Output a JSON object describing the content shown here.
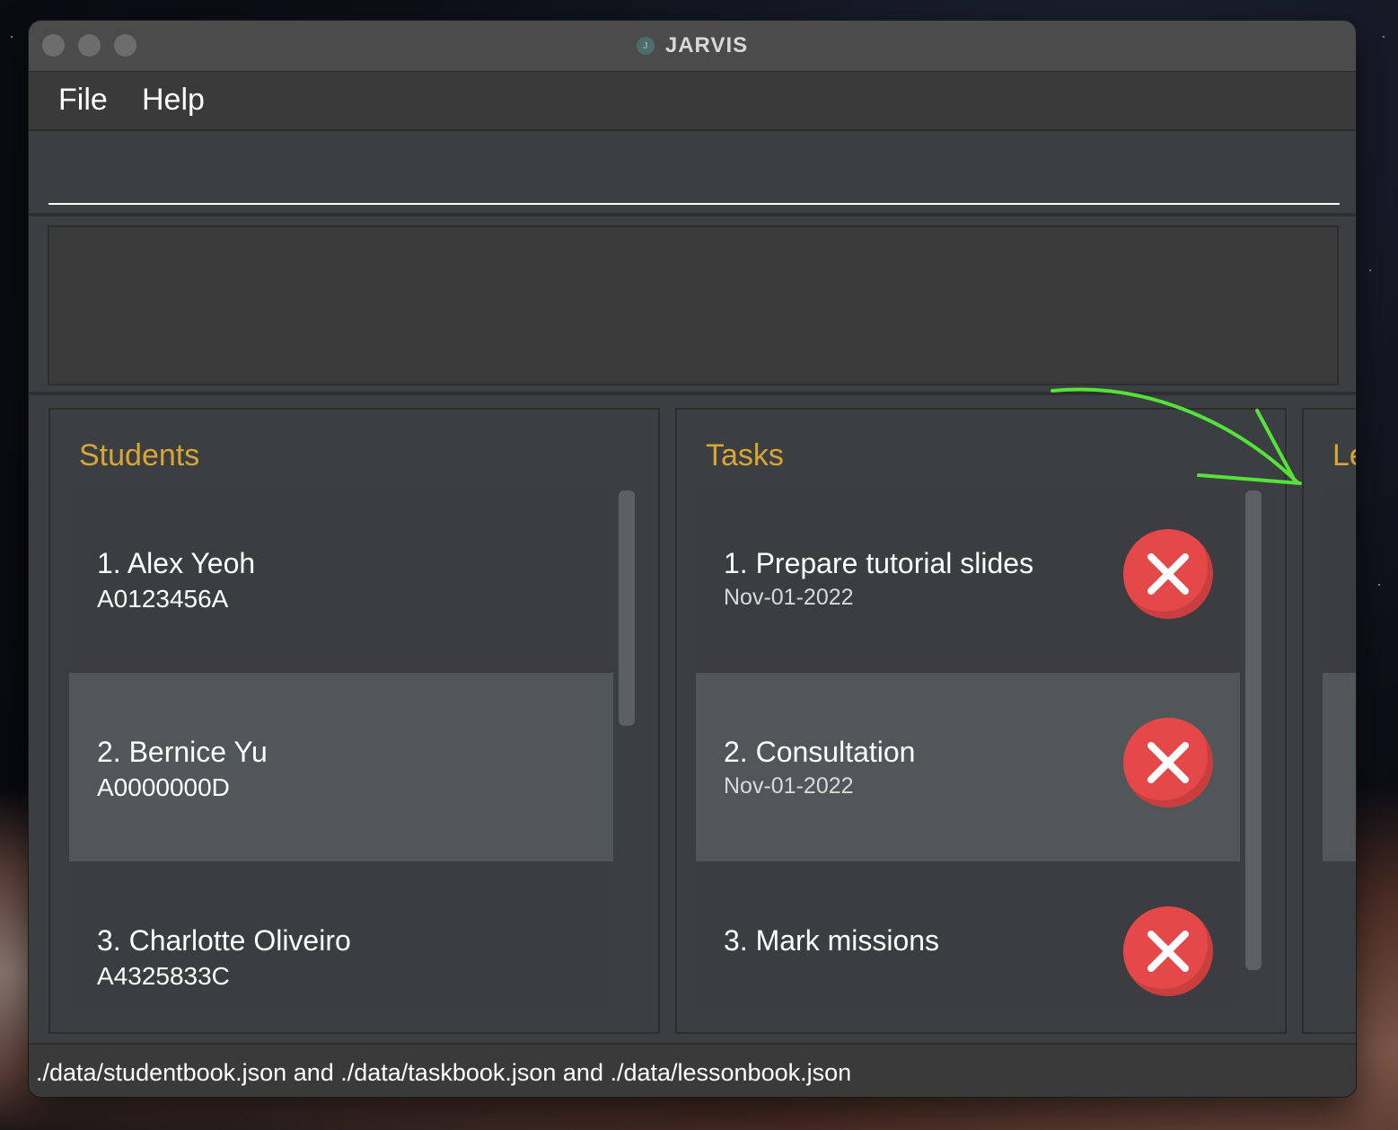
{
  "window": {
    "title": "JARVIS"
  },
  "menu": {
    "file": "File",
    "help": "Help"
  },
  "command": {
    "value": "",
    "placeholder": ""
  },
  "result": {
    "text": ""
  },
  "students": {
    "title": "Students",
    "items": [
      {
        "label": "1.  Alex Yeoh",
        "id": "A0123456A"
      },
      {
        "label": "2.  Bernice Yu",
        "id": "A0000000D"
      },
      {
        "label": "3.  Charlotte Oliveiro",
        "id": "A4325833C"
      }
    ]
  },
  "tasks": {
    "title": "Tasks",
    "items": [
      {
        "label": "1.  Prepare tutorial slides",
        "date": "Nov-01-2022"
      },
      {
        "label": "2.  Consultation",
        "date": "Nov-01-2022"
      },
      {
        "label": "3.  Mark missions",
        "date": ""
      }
    ]
  },
  "lessons": {
    "title": "Le"
  },
  "status": {
    "path": "./data/studentbook.json and ./data/taskbook.json and ./data/lessonbook.json"
  },
  "colors": {
    "accent": "#d8a637",
    "delete": "#e54848",
    "arrow": "#55e33a"
  }
}
